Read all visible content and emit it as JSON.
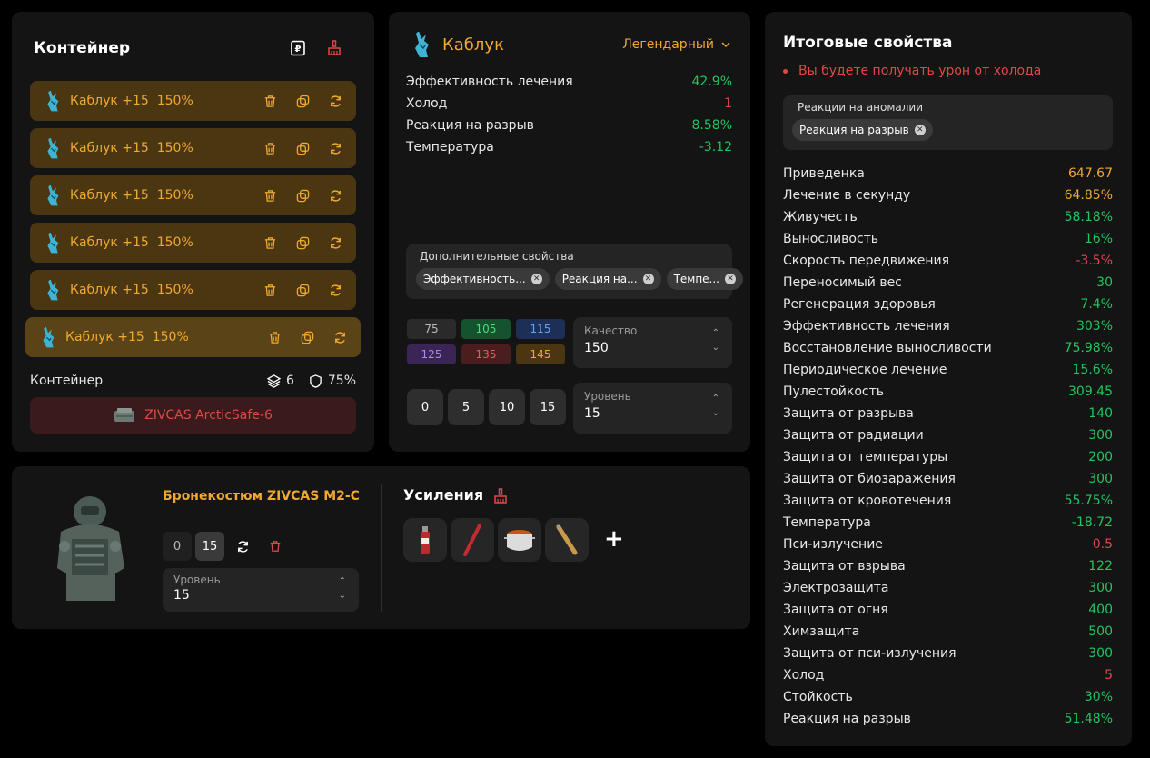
{
  "container": {
    "title": "Контейнер",
    "artifacts": [
      {
        "name": "Каблук +15  150%"
      },
      {
        "name": "Каблук +15  150%"
      },
      {
        "name": "Каблук +15  150%"
      },
      {
        "name": "Каблук +15  150%"
      },
      {
        "name": "Каблук +15  150%"
      },
      {
        "name": "Каблук +15  150%"
      }
    ],
    "footer_label": "Контейнер",
    "slots": "6",
    "protection": "75%",
    "item_name": "ZIVCAS ArcticSafe-6"
  },
  "artifact": {
    "name": "Каблук",
    "rarity": "Легендарный",
    "props": [
      {
        "label": "Эффективность лечения",
        "value": "42.9%",
        "color": "#22c55e"
      },
      {
        "label": "Холод",
        "value": "1",
        "color": "#e04848"
      },
      {
        "label": "Реакция на разрыв",
        "value": "8.58%",
        "color": "#22c55e"
      },
      {
        "label": "Температура",
        "value": "-3.12",
        "color": "#22c55e"
      }
    ],
    "extra_label": "Дополнительные свойства",
    "extra_chips": [
      "Эффективность...",
      "Реакция на...",
      "Темпе..."
    ],
    "quality_grid": [
      "75",
      "105",
      "115",
      "125",
      "135",
      "145"
    ],
    "quality_label": "Качество",
    "quality_value": "150",
    "level_buttons": [
      "0",
      "5",
      "10",
      "15"
    ],
    "level_label": "Уровень",
    "level_value": "15"
  },
  "armor": {
    "name": "Бронекостюм ZIVCAS M2-C",
    "level_buttons": [
      "0",
      "15"
    ],
    "level_label": "Уровень",
    "level_value": "15",
    "boosts_title": "Усиления",
    "add_label": "+"
  },
  "totals": {
    "title": "Итоговые свойства",
    "warning": "Вы будете получать урон от холода",
    "anomaly_label": "Реакции на аномалии",
    "anomaly_chip": "Реакция на разрыв",
    "rows": [
      {
        "label": "Приведенка",
        "value": "647.67",
        "color": "#f0a830"
      },
      {
        "label": "Лечение в секунду",
        "value": "64.85%",
        "color": "#f0a830"
      },
      {
        "label": "Живучесть",
        "value": "58.18%",
        "color": "#22c55e"
      },
      {
        "label": "Выносливость",
        "value": "16%",
        "color": "#22c55e"
      },
      {
        "label": "Скорость передвижения",
        "value": "-3.5%",
        "color": "#e04848"
      },
      {
        "label": "Переносимый вес",
        "value": "30",
        "color": "#22c55e"
      },
      {
        "label": "Регенерация здоровья",
        "value": "7.4%",
        "color": "#22c55e"
      },
      {
        "label": "Эффективность лечения",
        "value": "303%",
        "color": "#22c55e"
      },
      {
        "label": "Восстановление выносливости",
        "value": "75.98%",
        "color": "#22c55e"
      },
      {
        "label": "Периодическое лечение",
        "value": "15.6%",
        "color": "#22c55e"
      },
      {
        "label": "Пулестойкость",
        "value": "309.45",
        "color": "#22c55e"
      },
      {
        "label": "Защита от разрыва",
        "value": "140",
        "color": "#22c55e"
      },
      {
        "label": "Защита от радиации",
        "value": "300",
        "color": "#22c55e"
      },
      {
        "label": "Защита от температуры",
        "value": "200",
        "color": "#22c55e"
      },
      {
        "label": "Защита от биозаражения",
        "value": "300",
        "color": "#22c55e"
      },
      {
        "label": "Защита от кровотечения",
        "value": "55.75%",
        "color": "#22c55e"
      },
      {
        "label": "Температура",
        "value": "-18.72",
        "color": "#22c55e"
      },
      {
        "label": "Пси-излучение",
        "value": "0.5",
        "color": "#e04848"
      },
      {
        "label": "Защита от взрыва",
        "value": "122",
        "color": "#22c55e"
      },
      {
        "label": "Электрозащита",
        "value": "300",
        "color": "#22c55e"
      },
      {
        "label": "Защита от огня",
        "value": "400",
        "color": "#22c55e"
      },
      {
        "label": "Химзащита",
        "value": "500",
        "color": "#22c55e"
      },
      {
        "label": "Защита от пси-излучения",
        "value": "300",
        "color": "#22c55e"
      },
      {
        "label": "Холод",
        "value": "5",
        "color": "#e04848"
      },
      {
        "label": "Стойкость",
        "value": "30%",
        "color": "#22c55e"
      },
      {
        "label": "Реакция на разрыв",
        "value": "51.48%",
        "color": "#22c55e"
      }
    ]
  }
}
